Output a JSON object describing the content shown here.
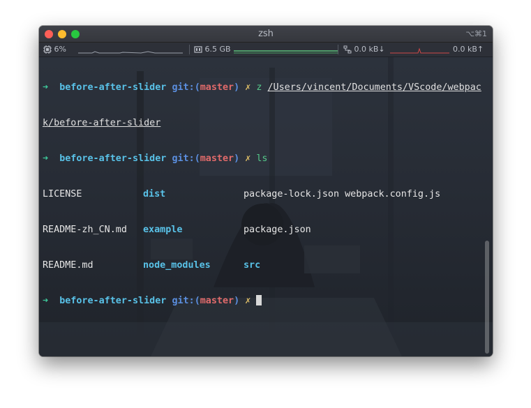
{
  "window": {
    "title": "zsh",
    "shortcut": "⌥⌘1",
    "traffic_lights": {
      "close": "#fe5f57",
      "minimize": "#febc2e",
      "zoom": "#28c840"
    }
  },
  "statusbar": {
    "cpu_icon": "cpu-icon",
    "cpu": "6%",
    "memory_icon": "memory-icon",
    "memory": "6.5 GB",
    "network_icon": "network-icon",
    "net_down": "0.0 kB↓",
    "net_up": "0.0 kB↑"
  },
  "terminal": {
    "prompt_arrow": "➜",
    "dir": "before-after-slider",
    "git_label": "git:",
    "paren_open": "(",
    "paren_close": ")",
    "branch": "master",
    "dirty_mark": "✗",
    "cmd1": "z",
    "cmd1_arg_line1": "/Users/vincent/Documents/VScode/webpac",
    "cmd1_arg_line2": "k/before-after-slider",
    "cmd2": "ls",
    "ls_output": [
      [
        "LICENSE",
        "dist",
        "package-lock.json",
        "webpack.config.js"
      ],
      [
        "README-zh_CN.md",
        "example",
        "package.json",
        ""
      ],
      [
        "README.md",
        "node_modules",
        "src",
        ""
      ]
    ]
  },
  "colors": {
    "terminal_bg": "#252a33",
    "prompt_arrow": "#3ec99b",
    "directory": "#59c2e8",
    "git": "#5b8fe0",
    "branch": "#e06a6a",
    "dirty": "#e0c068"
  }
}
